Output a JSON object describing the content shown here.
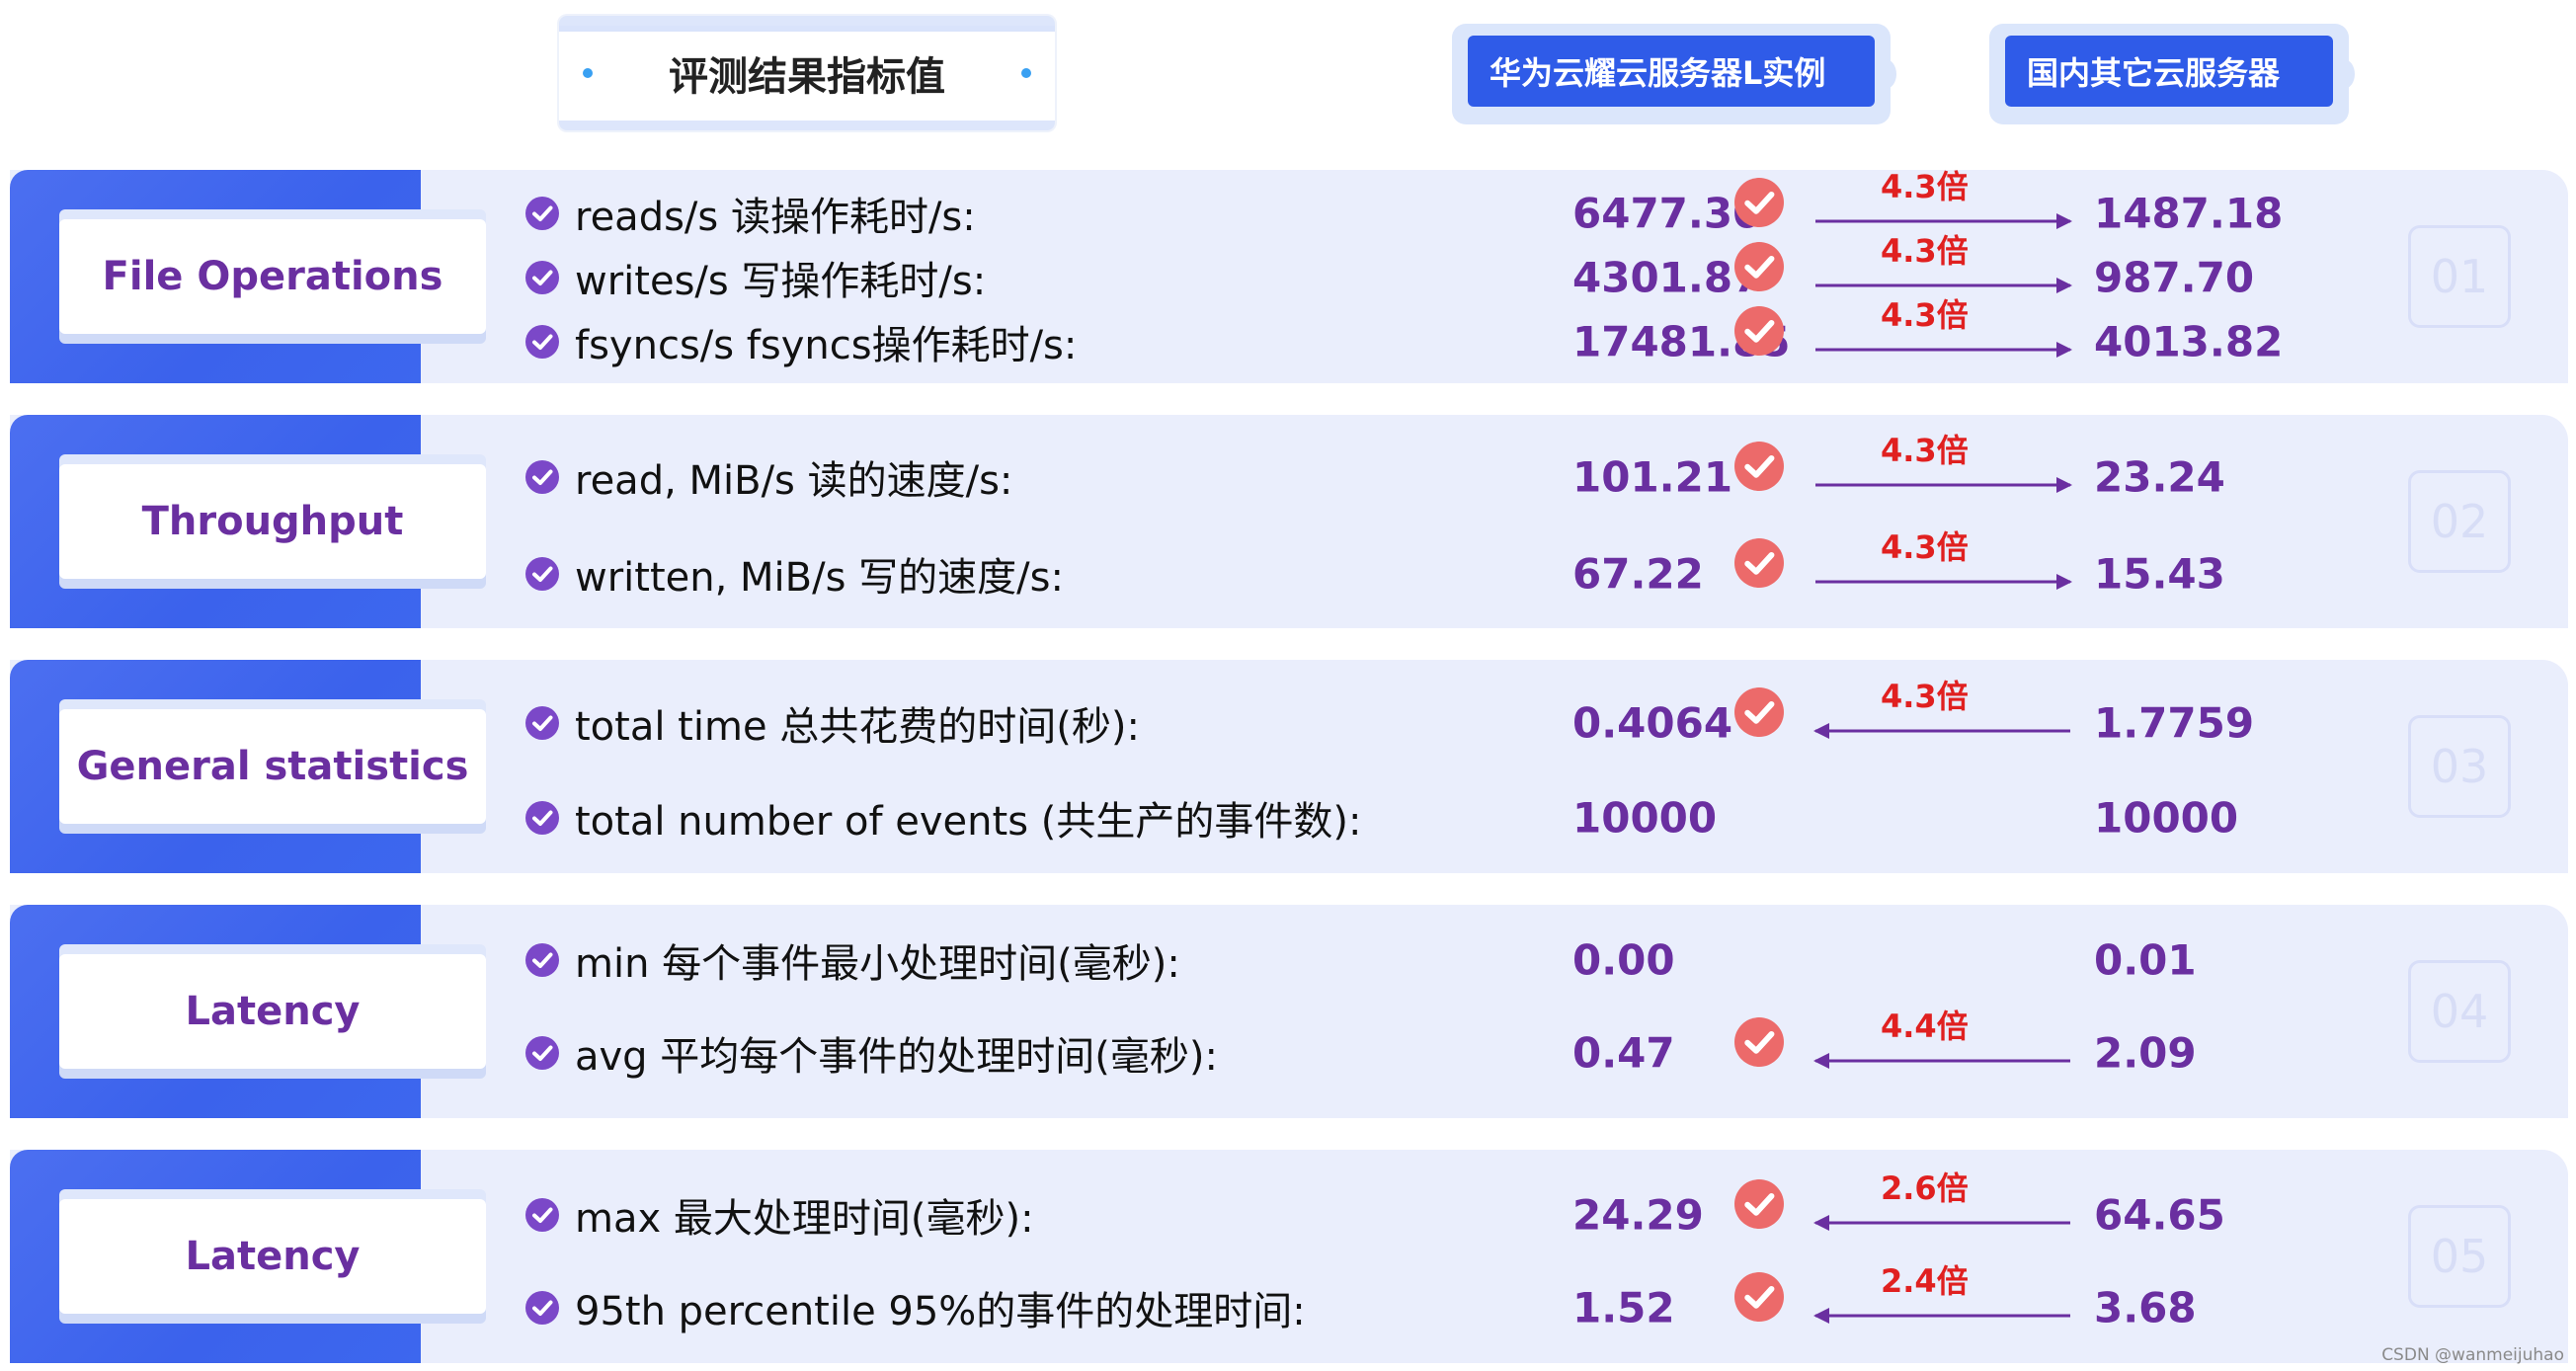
{
  "header": {
    "title": "评测结果指标值",
    "vendor_a": "华为云耀云服务器L实例",
    "vendor_b": "国内其它云服务器"
  },
  "sections": [
    {
      "category": "File Operations",
      "index": "01",
      "rows": [
        {
          "label": "reads/s 读操作耗时/s:",
          "a": "6477.30",
          "b": "1487.18",
          "ratio": "4.3倍",
          "winner": "a",
          "arrow": "right"
        },
        {
          "label": "writes/s 写操作耗时/s:",
          "a": "4301.87",
          "b": "987.70",
          "ratio": "4.3倍",
          "winner": "a",
          "arrow": "right"
        },
        {
          "label": "fsyncs/s fsyncs操作耗时/s:",
          "a": "17481.85",
          "b": "4013.82",
          "ratio": "4.3倍",
          "winner": "a",
          "arrow": "right"
        }
      ]
    },
    {
      "category": "Throughput",
      "index": "02",
      "rows": [
        {
          "label": "read, MiB/s 读的速度/s:",
          "a": "101.21",
          "b": "23.24",
          "ratio": "4.3倍",
          "winner": "a",
          "arrow": "right"
        },
        {
          "label": "written, MiB/s 写的速度/s:",
          "a": "67.22",
          "b": "15.43",
          "ratio": "4.3倍",
          "winner": "a",
          "arrow": "right"
        }
      ]
    },
    {
      "category": "General statistics",
      "index": "03",
      "rows": [
        {
          "label": "total time 总共花费的时间(秒):",
          "a": "0.4064",
          "b": "1.7759",
          "ratio": "4.3倍",
          "winner": "a",
          "arrow": "left"
        },
        {
          "label": "total number of events (共生产的事件数):",
          "a": "10000",
          "b": "10000",
          "ratio": "",
          "winner": "",
          "arrow": "none"
        }
      ]
    },
    {
      "category": "Latency",
      "index": "04",
      "rows": [
        {
          "label": "min 每个事件最小处理时间(毫秒):",
          "a": "0.00",
          "b": "0.01",
          "ratio": "",
          "winner": "",
          "arrow": "none"
        },
        {
          "label": "avg 平均每个事件的处理时间(毫秒):",
          "a": "0.47",
          "b": "2.09",
          "ratio": "4.4倍",
          "winner": "a",
          "arrow": "left"
        }
      ]
    },
    {
      "category": "Latency",
      "index": "05",
      "rows": [
        {
          "label": "max 最大处理时间(毫秒):",
          "a": "24.29",
          "b": "64.65",
          "ratio": "2.6倍",
          "winner": "a",
          "arrow": "left"
        },
        {
          "label": "95th percentile 95%的事件的处理时间:",
          "a": "1.52",
          "b": "3.68",
          "ratio": "2.4倍",
          "winner": "a",
          "arrow": "left"
        }
      ]
    }
  ],
  "watermark": "CSDN @wanmeijuhao",
  "colors": {
    "band_blue": "#3b62ec",
    "panel_bg": "#eaeefc",
    "category_text": "#6a2fa0",
    "value_text": "#6a2fa0",
    "ratio_red": "#e02020",
    "badge_red": "#ec6a6a",
    "arrow_purple": "#6a2fa0",
    "check_purple": "#7b48c8",
    "vendor_blue": "#2f5be8"
  }
}
